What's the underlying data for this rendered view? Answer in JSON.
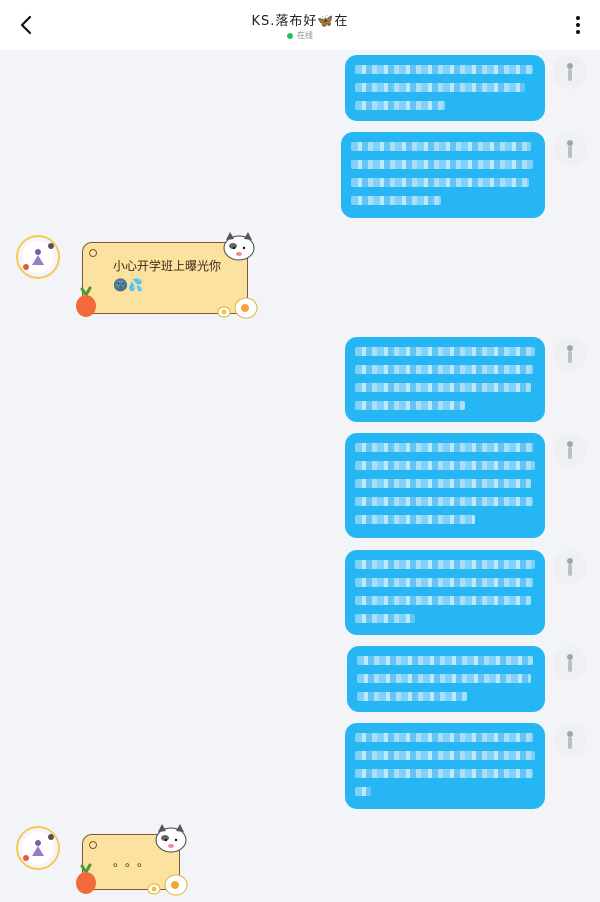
{
  "header": {
    "title": "KS.落布好🦋在",
    "status": "在线",
    "back_icon": "chevron-left-icon",
    "more_icon": "more-vertical-icon"
  },
  "messages": [
    {
      "side": "sent",
      "blurred": true
    },
    {
      "side": "sent",
      "blurred": true
    },
    {
      "side": "received",
      "text": "小心开学班上曝光你🌚💦"
    },
    {
      "side": "sent",
      "blurred": true
    },
    {
      "side": "sent",
      "blurred": true
    },
    {
      "side": "sent",
      "blurred": true
    },
    {
      "side": "sent",
      "blurred": true
    },
    {
      "side": "sent",
      "blurred": true
    },
    {
      "side": "received",
      "text": "。。。"
    }
  ],
  "colors": {
    "sent_bubble": "#27b6f4",
    "recv_bubble": "#fbe29f",
    "background": "#f2f4f8",
    "online": "#22c05a"
  }
}
